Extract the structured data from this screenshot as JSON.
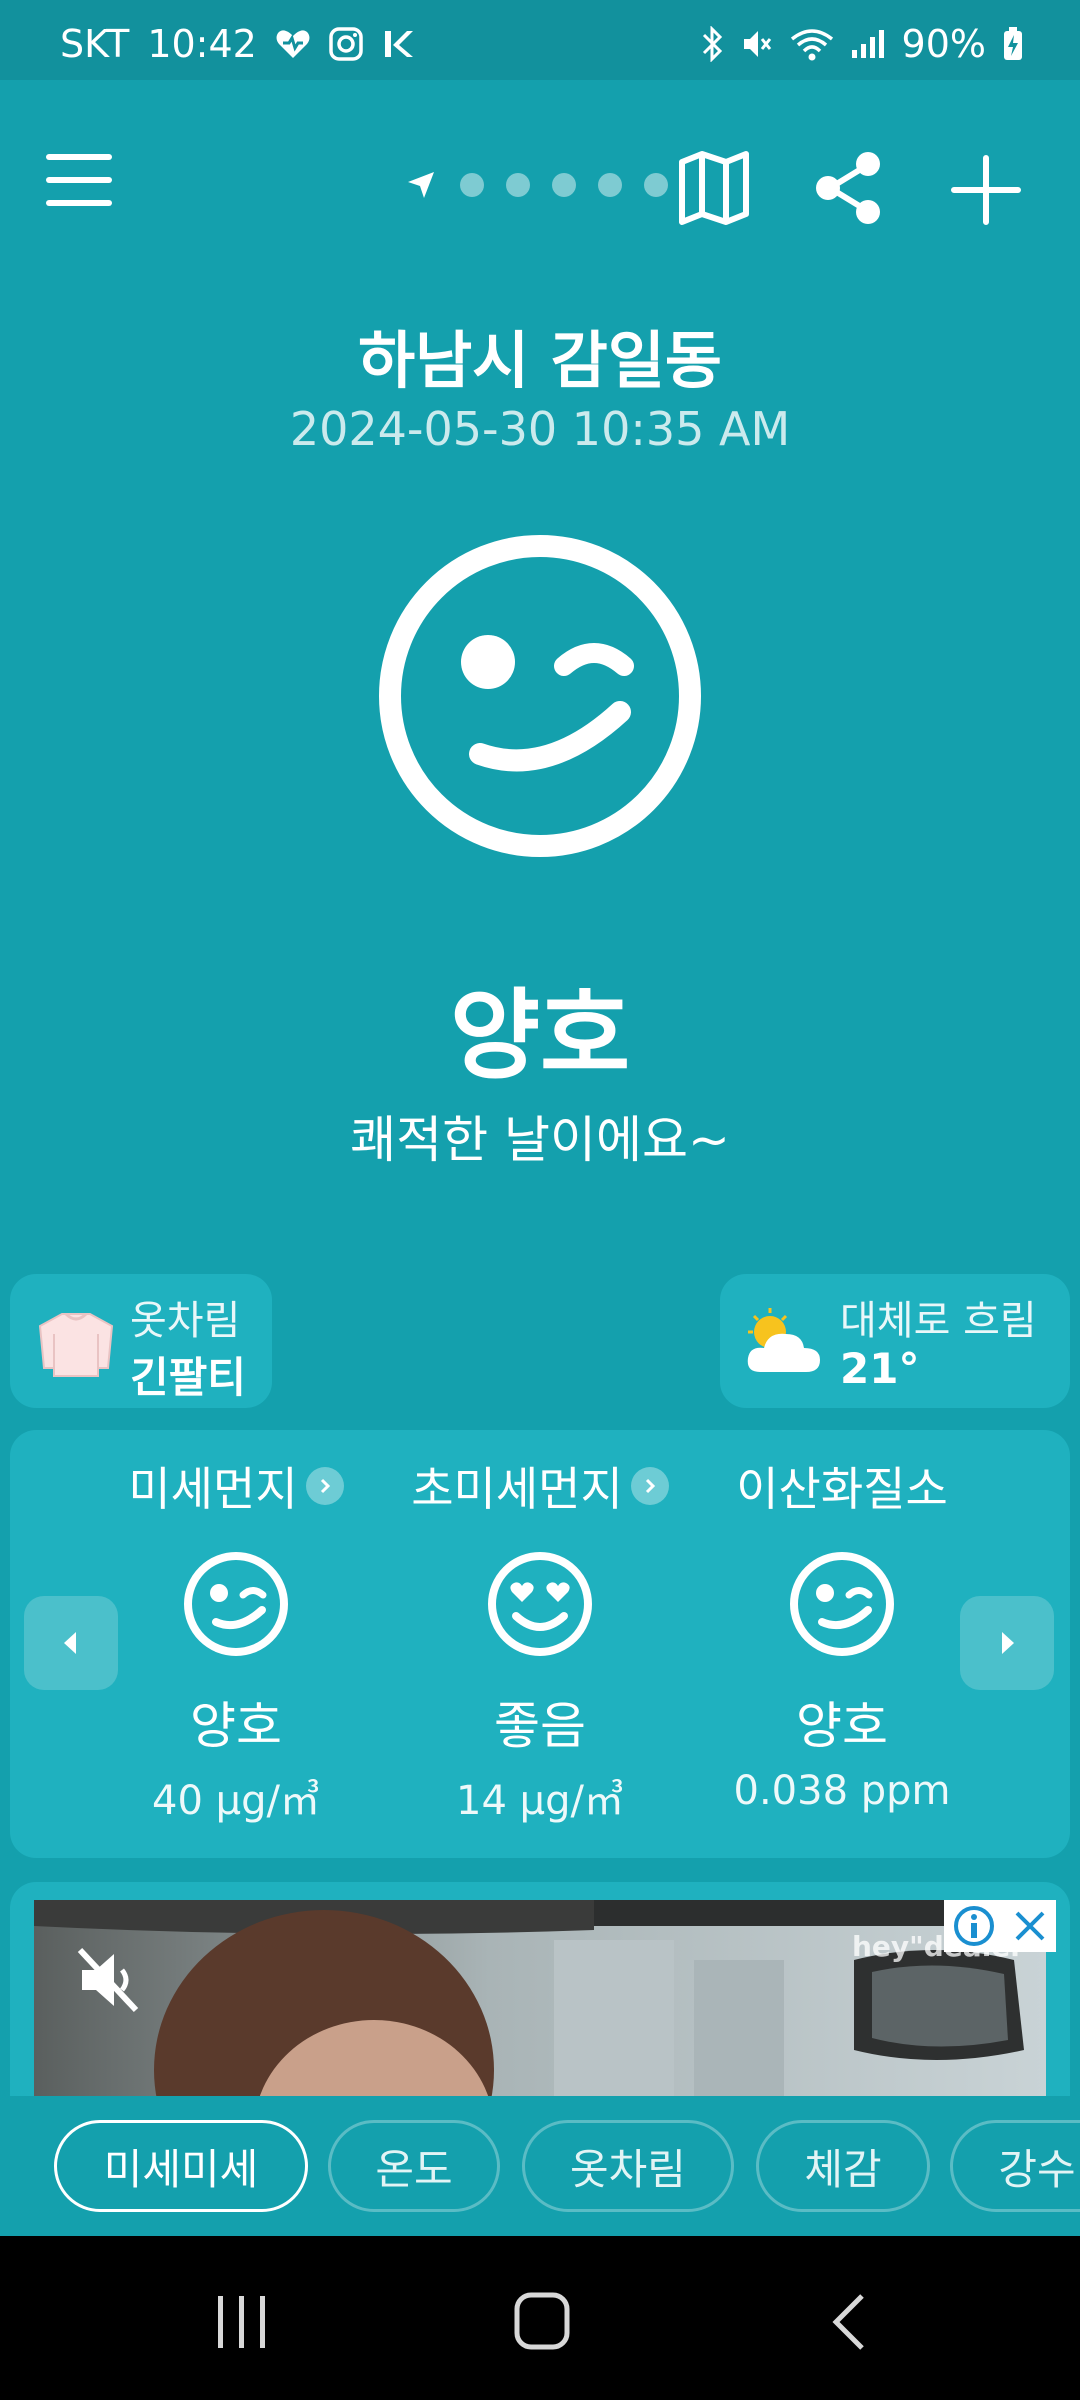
{
  "status_bar": {
    "carrier": "SKT",
    "time": "10:42",
    "battery": "90%"
  },
  "location": {
    "name": "하남시 감일동",
    "updated": "2024-05-30 10:35 AM"
  },
  "overall": {
    "grade": "양호",
    "message": "쾌적한 날이에요~"
  },
  "outfit": {
    "label": "옷차림",
    "value": "긴팔티"
  },
  "weather": {
    "condition": "대체로 흐림",
    "temperature": "21°"
  },
  "air_quality": [
    {
      "name": "미세먼지",
      "grade": "양호",
      "value": "40 μg/㎥",
      "face": "wink-face-icon",
      "has_link": true
    },
    {
      "name": "초미세먼지",
      "grade": "좋음",
      "value": "14 μg/㎥",
      "face": "heart-eyes-face-icon",
      "has_link": true
    },
    {
      "name": "이산화질소",
      "grade": "양호",
      "value": "0.038 ppm",
      "face": "wink-face-icon",
      "has_link": false
    }
  ],
  "ad": {
    "brand": "hey\"dealer"
  },
  "tabs": [
    {
      "label": "미세미세",
      "active": true
    },
    {
      "label": "온도",
      "active": false
    },
    {
      "label": "옷차림",
      "active": false
    },
    {
      "label": "체감",
      "active": false
    },
    {
      "label": "강수",
      "active": false
    }
  ],
  "colors": {
    "background": "#14a0ad",
    "card": "#1fb1bf",
    "status_bar": "#12919d"
  }
}
